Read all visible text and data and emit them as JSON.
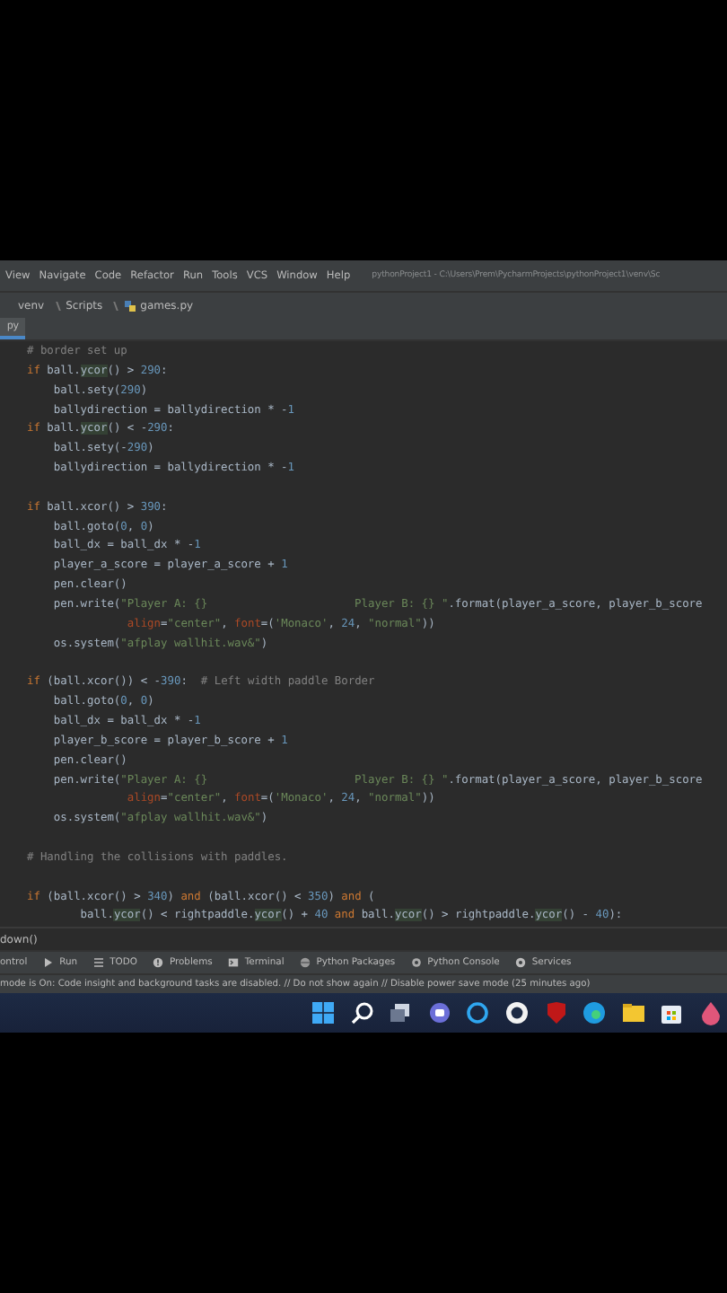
{
  "menu_bar": {
    "items": [
      "View",
      "Navigate",
      "Code",
      "Refactor",
      "Run",
      "Tools",
      "VCS",
      "Window",
      "Help"
    ],
    "title": "pythonProject1 - C:\\Users\\Prem\\PycharmProjects\\pythonProject1\\venv\\Sc"
  },
  "breadcrumb": [
    "venv",
    "Scripts",
    "games.py"
  ],
  "tabs": [
    {
      "label": "py",
      "selected": true
    }
  ],
  "code_lines": [
    {
      "kind": "code",
      "tokens": [
        {
          "kind": "cm",
          "text": "# border set up"
        }
      ]
    },
    {
      "kind": "code",
      "tokens": [
        {
          "kind": "kw",
          "text": "if"
        },
        {
          "kind": "id",
          "text": " ball."
        },
        {
          "kind": "hl",
          "text": "ycor"
        },
        {
          "kind": "id",
          "text": "() > "
        },
        {
          "kind": "num",
          "text": "290"
        },
        {
          "kind": "id",
          "text": ":"
        }
      ]
    },
    {
      "kind": "code",
      "tokens": [
        {
          "kind": "id",
          "text": "    ball.sety("
        },
        {
          "kind": "num",
          "text": "290"
        },
        {
          "kind": "id",
          "text": ")"
        }
      ]
    },
    {
      "kind": "code",
      "tokens": [
        {
          "kind": "id",
          "text": "    ballydirection = ballydirection * -"
        },
        {
          "kind": "num",
          "text": "1"
        }
      ]
    },
    {
      "kind": "code",
      "tokens": [
        {
          "kind": "kw",
          "text": "if"
        },
        {
          "kind": "id",
          "text": " ball."
        },
        {
          "kind": "hl",
          "text": "ycor"
        },
        {
          "kind": "id",
          "text": "() < -"
        },
        {
          "kind": "num",
          "text": "290"
        },
        {
          "kind": "id",
          "text": ":"
        }
      ]
    },
    {
      "kind": "code",
      "tokens": [
        {
          "kind": "id",
          "text": "    ball.sety(-"
        },
        {
          "kind": "num",
          "text": "290"
        },
        {
          "kind": "id",
          "text": ")"
        }
      ]
    },
    {
      "kind": "code",
      "tokens": [
        {
          "kind": "id",
          "text": "    ballydirection = ballydirection * -"
        },
        {
          "kind": "num",
          "text": "1"
        }
      ]
    },
    {
      "kind": "blank"
    },
    {
      "kind": "code",
      "tokens": [
        {
          "kind": "kw",
          "text": "if"
        },
        {
          "kind": "id",
          "text": " ball.xcor() > "
        },
        {
          "kind": "num",
          "text": "390"
        },
        {
          "kind": "id",
          "text": ":"
        }
      ]
    },
    {
      "kind": "code",
      "tokens": [
        {
          "kind": "id",
          "text": "    ball.goto("
        },
        {
          "kind": "num",
          "text": "0"
        },
        {
          "kind": "id",
          "text": ", "
        },
        {
          "kind": "num",
          "text": "0"
        },
        {
          "kind": "id",
          "text": ")"
        }
      ]
    },
    {
      "kind": "code",
      "tokens": [
        {
          "kind": "id",
          "text": "    ball_dx = ball_dx * -"
        },
        {
          "kind": "num",
          "text": "1"
        }
      ]
    },
    {
      "kind": "code",
      "tokens": [
        {
          "kind": "id",
          "text": "    player_a_score = player_a_score + "
        },
        {
          "kind": "num",
          "text": "1"
        }
      ]
    },
    {
      "kind": "code",
      "tokens": [
        {
          "kind": "id",
          "text": "    pen.clear()"
        }
      ]
    },
    {
      "kind": "code",
      "tokens": [
        {
          "kind": "id",
          "text": "    pen.write("
        },
        {
          "kind": "str",
          "text": "\"Player A: {}                      Player B: {} \""
        },
        {
          "kind": "id",
          "text": ".format(player_a_score, player_b_score"
        }
      ]
    },
    {
      "kind": "code",
      "tokens": [
        {
          "kind": "arg",
          "text": "               align"
        },
        {
          "kind": "id",
          "text": "="
        },
        {
          "kind": "str",
          "text": "\"center\""
        },
        {
          "kind": "id",
          "text": ", "
        },
        {
          "kind": "arg",
          "text": "font"
        },
        {
          "kind": "id",
          "text": "=("
        },
        {
          "kind": "str",
          "text": "'Monaco'"
        },
        {
          "kind": "id",
          "text": ", "
        },
        {
          "kind": "num",
          "text": "24"
        },
        {
          "kind": "id",
          "text": ", "
        },
        {
          "kind": "str",
          "text": "\"normal\""
        },
        {
          "kind": "id",
          "text": "))"
        }
      ]
    },
    {
      "kind": "code",
      "tokens": [
        {
          "kind": "id",
          "text": "    os.system("
        },
        {
          "kind": "str",
          "text": "\"afplay wallhit.wav&\""
        },
        {
          "kind": "id",
          "text": ")"
        }
      ]
    },
    {
      "kind": "blank"
    },
    {
      "kind": "code",
      "tokens": [
        {
          "kind": "kw",
          "text": "if"
        },
        {
          "kind": "id",
          "text": " (ball.xcor()) < -"
        },
        {
          "kind": "num",
          "text": "390"
        },
        {
          "kind": "id",
          "text": ":  "
        },
        {
          "kind": "cm",
          "text": "# Left width paddle Border"
        }
      ]
    },
    {
      "kind": "code",
      "tokens": [
        {
          "kind": "id",
          "text": "    ball.goto("
        },
        {
          "kind": "num",
          "text": "0"
        },
        {
          "kind": "id",
          "text": ", "
        },
        {
          "kind": "num",
          "text": "0"
        },
        {
          "kind": "id",
          "text": ")"
        }
      ]
    },
    {
      "kind": "code",
      "tokens": [
        {
          "kind": "id",
          "text": "    ball_dx = ball_dx * -"
        },
        {
          "kind": "num",
          "text": "1"
        }
      ]
    },
    {
      "kind": "code",
      "tokens": [
        {
          "kind": "id",
          "text": "    player_b_score = player_b_score + "
        },
        {
          "kind": "num",
          "text": "1"
        }
      ]
    },
    {
      "kind": "code",
      "tokens": [
        {
          "kind": "id",
          "text": "    pen.clear()"
        }
      ]
    },
    {
      "kind": "code",
      "tokens": [
        {
          "kind": "id",
          "text": "    pen.write("
        },
        {
          "kind": "str",
          "text": "\"Player A: {}                      Player B: {} \""
        },
        {
          "kind": "id",
          "text": ".format(player_a_score, player_b_score"
        }
      ]
    },
    {
      "kind": "code",
      "tokens": [
        {
          "kind": "arg",
          "text": "               align"
        },
        {
          "kind": "id",
          "text": "="
        },
        {
          "kind": "str",
          "text": "\"center\""
        },
        {
          "kind": "id",
          "text": ", "
        },
        {
          "kind": "arg",
          "text": "font"
        },
        {
          "kind": "id",
          "text": "=("
        },
        {
          "kind": "str",
          "text": "'Monaco'"
        },
        {
          "kind": "id",
          "text": ", "
        },
        {
          "kind": "num",
          "text": "24"
        },
        {
          "kind": "id",
          "text": ", "
        },
        {
          "kind": "str",
          "text": "\"normal\""
        },
        {
          "kind": "id",
          "text": "))"
        }
      ]
    },
    {
      "kind": "code",
      "tokens": [
        {
          "kind": "id",
          "text": "    os.system("
        },
        {
          "kind": "str",
          "text": "\"afplay wallhit.wav&\""
        },
        {
          "kind": "id",
          "text": ")"
        }
      ]
    },
    {
      "kind": "blank"
    },
    {
      "kind": "code",
      "tokens": [
        {
          "kind": "cm",
          "text": "# Handling the collisions with paddles."
        }
      ]
    },
    {
      "kind": "blank"
    },
    {
      "kind": "code",
      "tokens": [
        {
          "kind": "kw",
          "text": "if"
        },
        {
          "kind": "id",
          "text": " (ball.xcor() > "
        },
        {
          "kind": "num",
          "text": "340"
        },
        {
          "kind": "id",
          "text": ") "
        },
        {
          "kind": "kw",
          "text": "and"
        },
        {
          "kind": "id",
          "text": " (ball.xcor() < "
        },
        {
          "kind": "num",
          "text": "350"
        },
        {
          "kind": "id",
          "text": ") "
        },
        {
          "kind": "kw",
          "text": "and"
        },
        {
          "kind": "id",
          "text": " ("
        }
      ]
    },
    {
      "kind": "code",
      "tokens": [
        {
          "kind": "id",
          "text": "        ball."
        },
        {
          "kind": "hl",
          "text": "ycor"
        },
        {
          "kind": "id",
          "text": "() < rightpaddle."
        },
        {
          "kind": "hl",
          "text": "ycor"
        },
        {
          "kind": "id",
          "text": "() + "
        },
        {
          "kind": "num",
          "text": "40"
        },
        {
          "kind": "kw",
          "text": " and"
        },
        {
          "kind": "id",
          "text": " ball."
        },
        {
          "kind": "hl",
          "text": "ycor"
        },
        {
          "kind": "id",
          "text": "() > rightpaddle."
        },
        {
          "kind": "hl",
          "text": "ycor"
        },
        {
          "kind": "id",
          "text": "() - "
        },
        {
          "kind": "num",
          "text": "40"
        },
        {
          "kind": "id",
          "text": "):"
        }
      ]
    }
  ],
  "console": {
    "text": "down()"
  },
  "tool_windows": [
    "ontrol",
    "Run",
    "TODO",
    "Problems",
    "Terminal",
    "Python Packages",
    "Python Console",
    "Services"
  ],
  "status_bar": "mode is On: Code insight and background tasks are disabled. // Do not show again // Disable power save mode (25 minutes ago)"
}
